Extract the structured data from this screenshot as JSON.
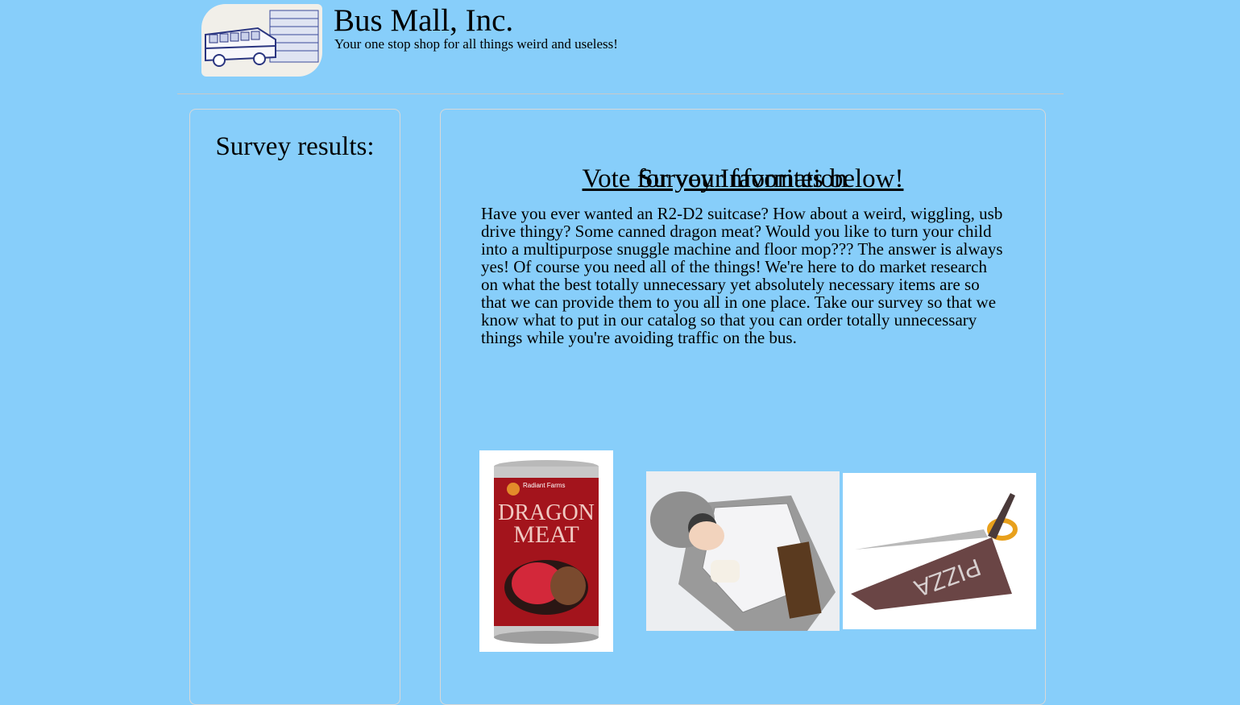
{
  "header": {
    "title": "Bus Mall, Inc.",
    "tagline": "Your one stop shop for all things weird and useless!",
    "logo_icon": "school-bus-icon"
  },
  "results": {
    "heading": "Survey results:"
  },
  "info": {
    "heading": "Survey Information",
    "body": "Have you ever wanted an R2-D2 suitcase? How about a weird, wiggling, usb drive thingy? Some canned dragon meat? Would you like to turn your child into a multipurpose snuggle machine and floor mop??? The answer is always yes! Of course you need all of the things! We're here to do market research on what the best totally unnecessary yet absolutely necessary items are so that we can provide them to you all in one place. Take our survey so that we know what to put in our catalog so that you can order totally unnecessary things while you're avoiding traffic on the bus.",
    "vote_heading": "Vote for your favorites below!"
  },
  "products": [
    {
      "icon": "dragon-meat-can-icon",
      "brand": "Radiant Farms",
      "label_line1": "DRAGON",
      "label_line2": "MEAT"
    },
    {
      "icon": "tauntaun-sleeping-bag-icon"
    },
    {
      "icon": "pizza-scissors-icon",
      "word": "PIZZA"
    }
  ],
  "colors": {
    "background": "#87cefa",
    "panel_border": "#d8d8d8"
  }
}
